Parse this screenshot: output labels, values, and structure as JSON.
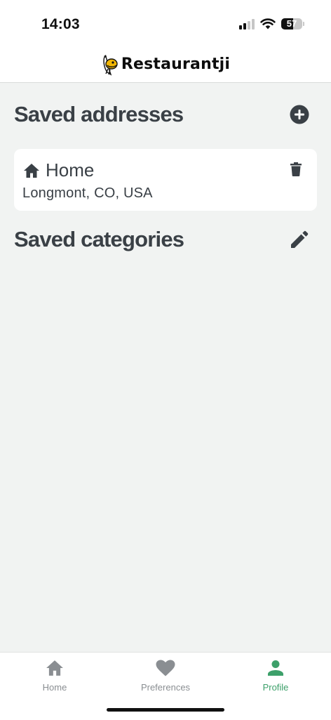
{
  "status_bar": {
    "time": "14:03",
    "battery_level": "57"
  },
  "app": {
    "brand_name": "Restaurantji",
    "logo_icon": "restaurantji-bird-logo"
  },
  "saved_addresses": {
    "title": "Saved addresses",
    "add_icon": "add-circle-icon",
    "items": [
      {
        "name": "Home",
        "icon": "home-icon",
        "location": "Longmont, CO, USA",
        "delete_icon": "trash-icon"
      }
    ]
  },
  "saved_categories": {
    "title": "Saved categories",
    "edit_icon": "pencil-icon"
  },
  "bottom_nav": {
    "items": [
      {
        "label": "Home",
        "icon": "home-icon",
        "active": false
      },
      {
        "label": "Preferences",
        "icon": "heart-icon",
        "active": false
      },
      {
        "label": "Profile",
        "icon": "person-icon",
        "active": true
      }
    ],
    "active_color": "#3da06a",
    "inactive_color": "#8a8e92"
  },
  "colors": {
    "page_background": "#f1f3f2",
    "card_background": "#ffffff",
    "text_primary": "#3a4046"
  }
}
